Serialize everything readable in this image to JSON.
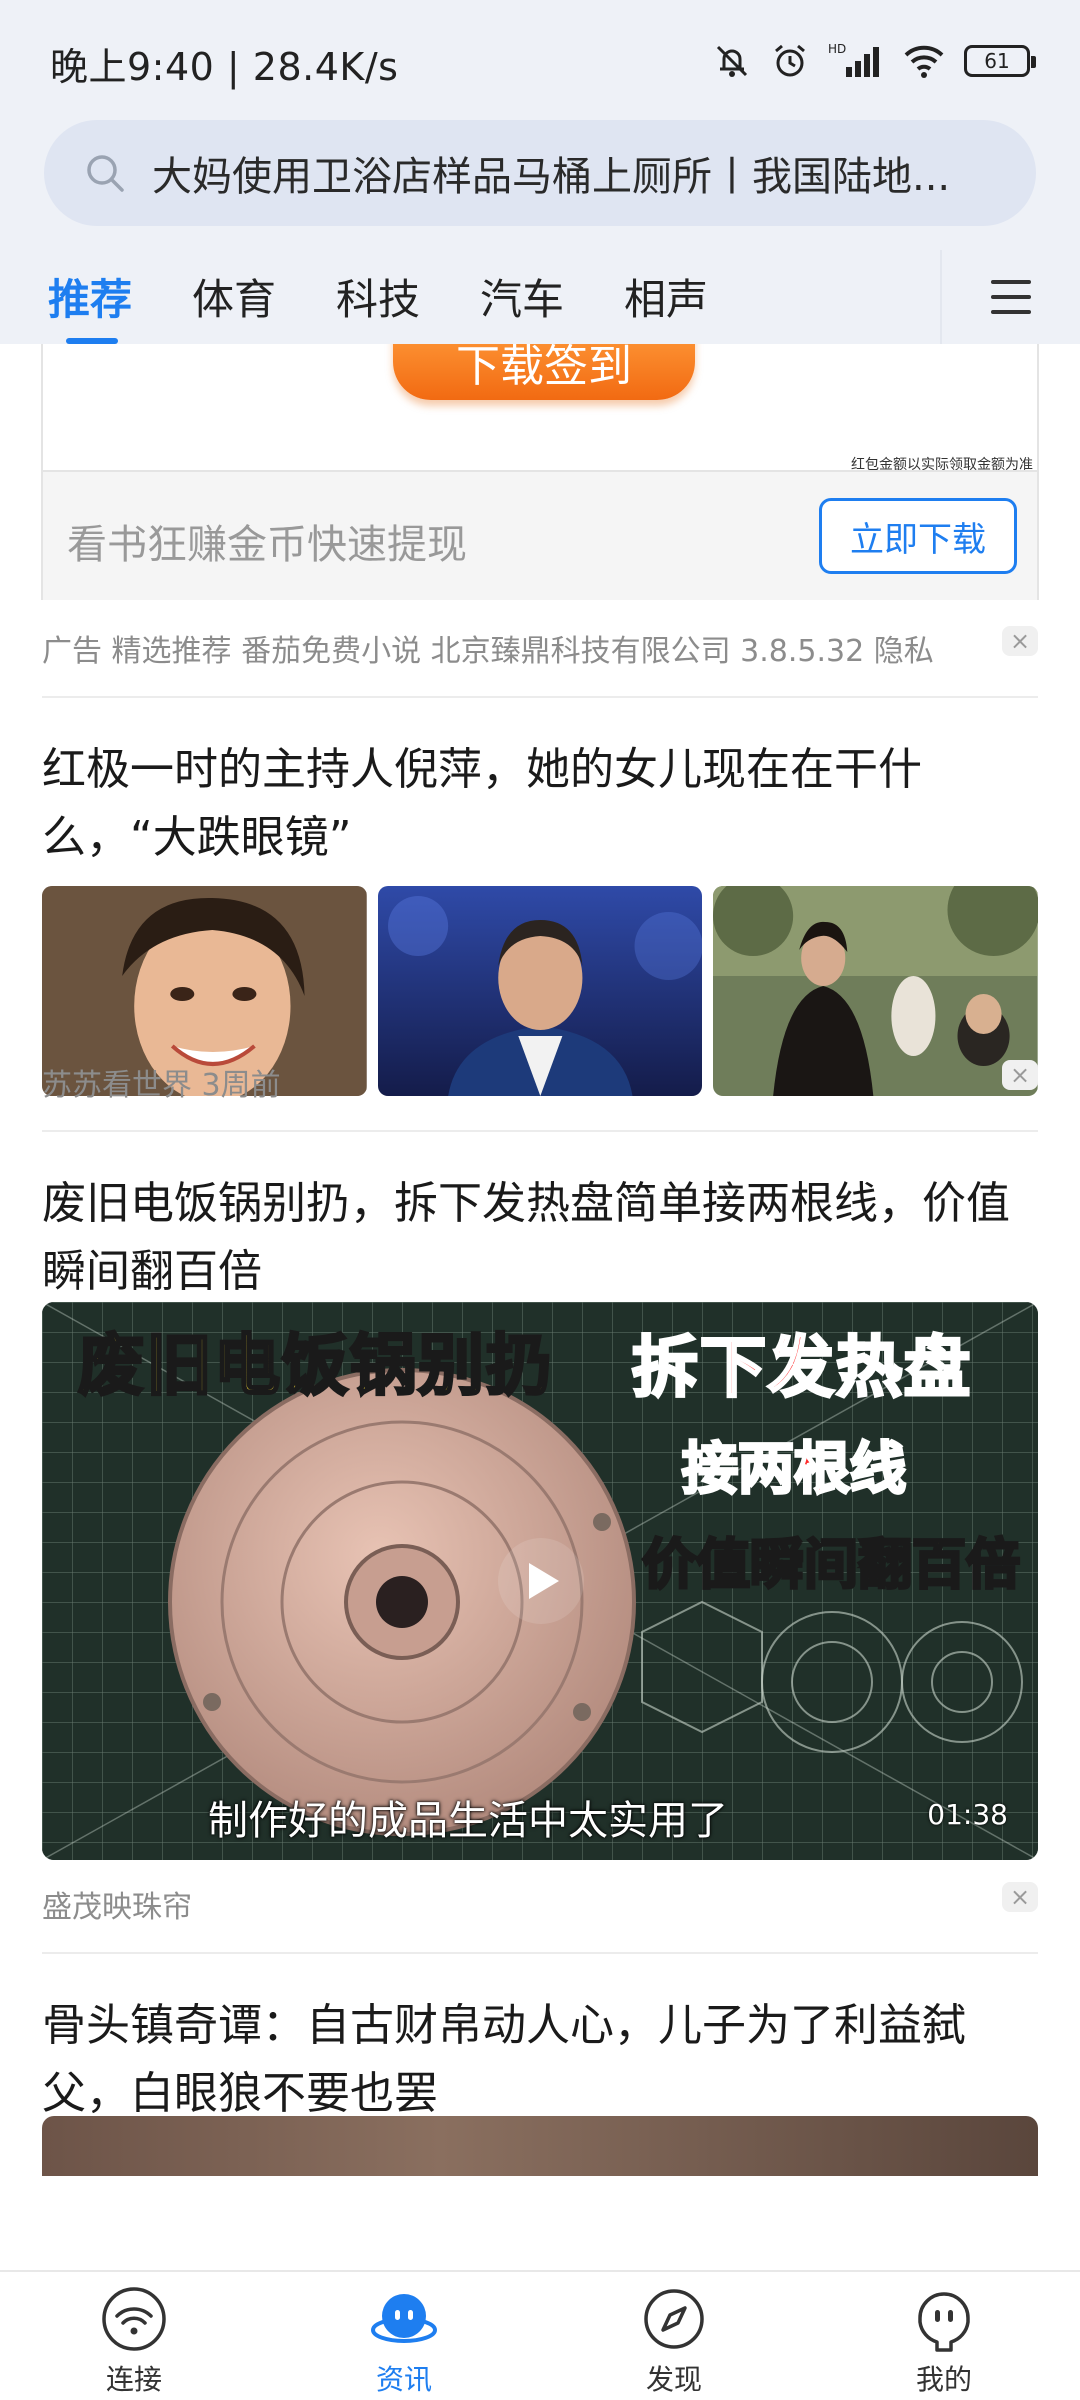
{
  "status_bar": {
    "time_speed": "晚上9:40 | 28.4K/s",
    "battery": "61",
    "network_label": "HD"
  },
  "search": {
    "text": "大妈使用卫浴店样品马桶上厕所丨我国陆地..."
  },
  "tabs": [
    {
      "label": "推荐",
      "active": true
    },
    {
      "label": "体育",
      "active": false
    },
    {
      "label": "科技",
      "active": false
    },
    {
      "label": "汽车",
      "active": false
    },
    {
      "label": "相声",
      "active": false
    }
  ],
  "ad": {
    "button_label": "下载签到",
    "fine_print": "红包金额以实际领取金额为准",
    "footer_text": "看书狂赚金币快速提现",
    "cta_label": "立即下载",
    "meta": "广告  精选推荐  番茄免费小说  北京臻鼎科技有限公司 3.8.5.32 隐私"
  },
  "articles": [
    {
      "title": "红极一时的主持人倪萍，她的女儿现在在干什么，“大跌眼镜”",
      "source_time": "苏苏看世界  3周前"
    },
    {
      "title": "废旧电饭锅别扔，拆下发热盘简单接两根线，价值瞬间翻百倍",
      "source_time": "盛茂映珠帘",
      "video": {
        "overlay_title_yellow": "废旧电饭锅别扔",
        "overlay_title_red": "拆下发热盘",
        "overlay_sub_red": "接两根线",
        "overlay_sub_yellow": "价值瞬间翻百倍",
        "caption": "制作好的成品生活中太实用了",
        "duration": "01:38"
      }
    },
    {
      "title": "骨头镇奇谭：自古财帛动人心，儿子为了利益弑父，白眼狼不要也罢"
    }
  ],
  "close_symbol": "×",
  "bottom_nav": [
    {
      "label": "连接",
      "icon": "wifi-icon",
      "active": false
    },
    {
      "label": "资讯",
      "icon": "news-face-icon",
      "active": true
    },
    {
      "label": "发现",
      "icon": "compass-icon",
      "active": false
    },
    {
      "label": "我的",
      "icon": "profile-face-icon",
      "active": false
    }
  ],
  "colors": {
    "accent": "#1e7ef0",
    "header_bg": "#eef1f7",
    "ad_button": "#f26a12"
  }
}
